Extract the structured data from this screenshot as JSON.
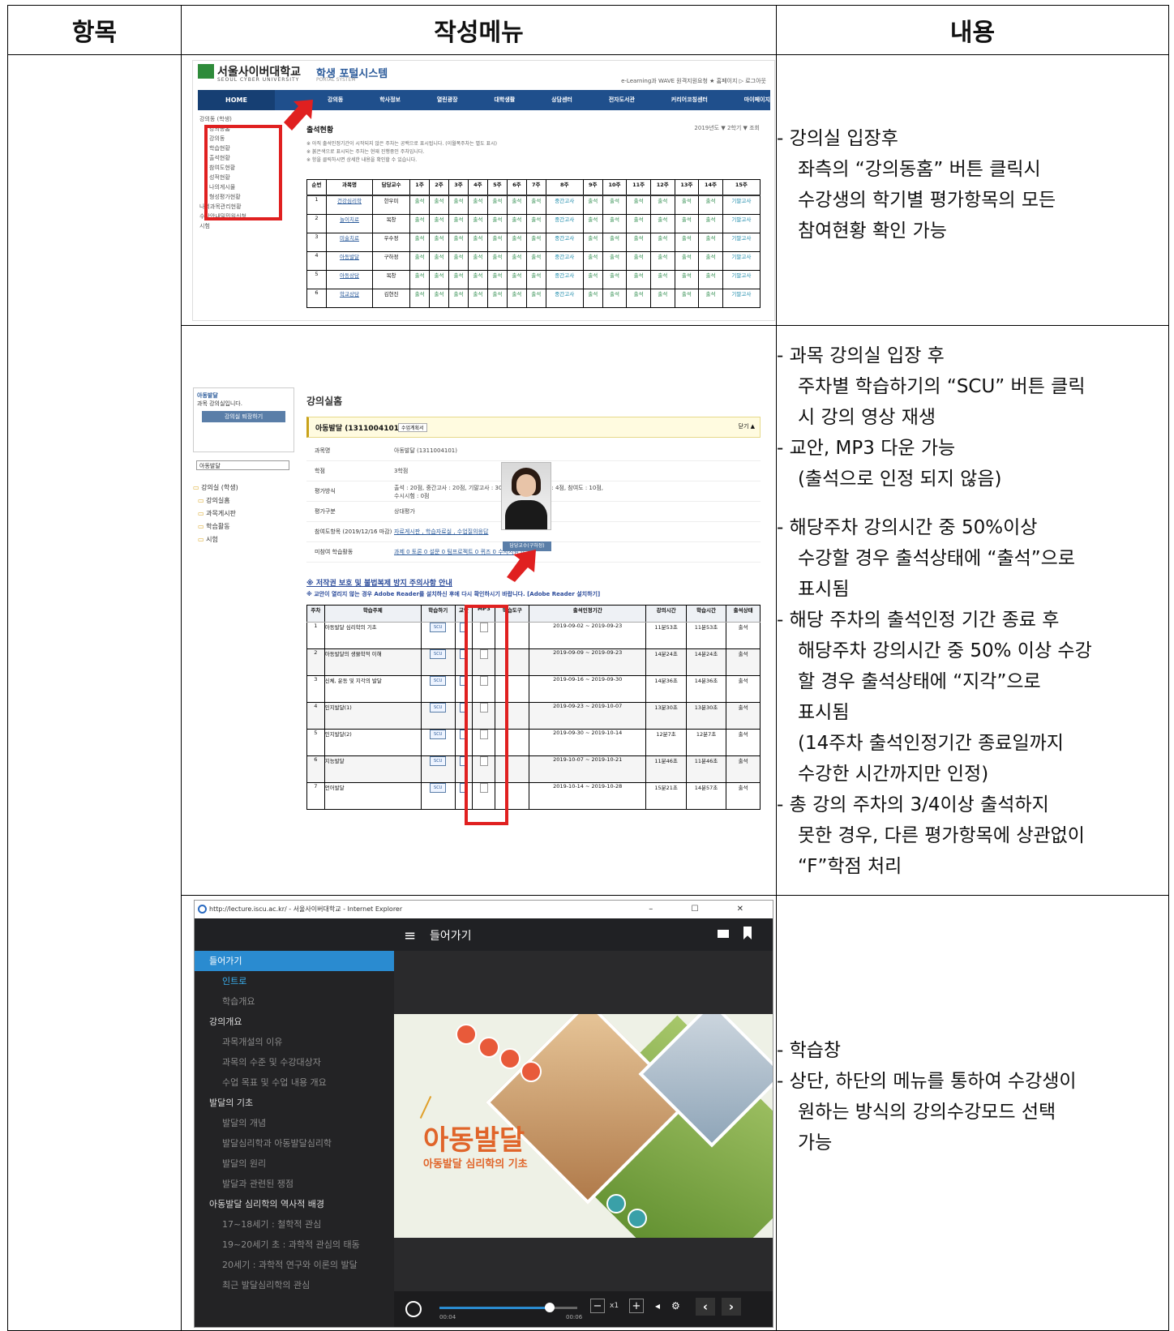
{
  "headers": [
    "항목",
    "작성메뉴",
    "내용"
  ],
  "row1": {
    "shot": {
      "logo_name": "서울사이버대학교",
      "logo_sub": "SEOUL CYBER UNIVERSITY",
      "portal_title": "학생 포털시스템",
      "portal_sub": "PORTAL SYSTEM",
      "top_links": "e-Learning과 WAVE   원격지원요청   ★ 홈페이지   ▷ 로그아웃",
      "nav_home": "HOME",
      "nav_items": [
        "강의동",
        "학사정보",
        "열린광장",
        "대학생활",
        "상담센터",
        "전자도서관",
        "커리어코칭센터",
        "마이페이지"
      ],
      "left_menu": [
        "강의동 (학생)",
        "강의동홈",
        "강의동",
        "학습현황",
        "출석현황",
        "참여도현황",
        "성적현황",
        "나의게시물",
        "형성평가현황",
        "나의과목관리현황",
        "수강안내및민원신청",
        "시험"
      ],
      "page_title": "출석현황",
      "notes": [
        "※ 아직 출석인정기간이 시작되지 않은 주차는 공백으로 표시됩니다. (이월폭주차는 별도 표시)",
        "※ 붉은색으로 표시되는 주차는 현재 진행중인 주차입니다.",
        "※ 항을 클릭하시면 상세한 내용을 확인할 수 있습니다."
      ],
      "select": "2019년도 ▼ 2학기 ▼ 조회",
      "columns": [
        "순번",
        "과목명",
        "담당교수",
        "1주",
        "2주",
        "3주",
        "4주",
        "5주",
        "6주",
        "7주",
        "8주",
        "9주",
        "10주",
        "11주",
        "12주",
        "13주",
        "14주",
        "15주"
      ],
      "rows": [
        {
          "no": "1",
          "course": "건강심리학",
          "prof": "한우미"
        },
        {
          "no": "2",
          "course": "놀이치료",
          "prof": "목창"
        },
        {
          "no": "3",
          "course": "미술치료",
          "prof": "우수정"
        },
        {
          "no": "4",
          "course": "아동발달",
          "prof": "구하정"
        },
        {
          "no": "5",
          "course": "아동상담",
          "prof": "목창"
        },
        {
          "no": "6",
          "course": "학교상담",
          "prof": "김현진"
        }
      ],
      "cell_attend": "출석",
      "cell_mid": "중간고사",
      "cell_final": "기말고사"
    },
    "desc": [
      "- 강의실 입장후",
      "좌측의 “강의동홈” 버튼 클릭시",
      "수강생의 학기별 평가항목의 모든",
      "참여현황 확인 가능"
    ]
  },
  "row2": {
    "shot": {
      "side_course": "아동발달",
      "side_text": "과목 강의실입니다.",
      "side_btn": "강의실 퇴장하기",
      "side_select": "아동발달",
      "side_tree": [
        "강의실 (학생)",
        "강의실홈",
        "과목게시판",
        "학습활동",
        "시험"
      ],
      "title": "강의실홈",
      "course": "아동발달 (1311004101)",
      "course_tag": "수업계획서",
      "course_hide": "닫기 ▲",
      "info": [
        {
          "k": "과목명",
          "v": "아동발달 (1311004101)"
        },
        {
          "k": "학점",
          "v": "3학점"
        },
        {
          "k": "평가방식",
          "v": "출석 : 20점, 중간고사 : 20점, 기말고사 : 30점, 과제 : 0점, 토론 : 4점, 참여도 : 10점, 수시시험 : 0점"
        },
        {
          "k": "평가구분",
          "v": "상대평가"
        },
        {
          "k": "참여도항목 (2019/12/16 마감)",
          "v": "자료게시판 , 학습자료실 , 수업질의응답"
        },
        {
          "k": "미참여 학습활동",
          "v": "과제 0  토론 0  설문 0  팀프로젝트 0  퀴즈 0  수시시험 0"
        }
      ],
      "teacher_btn": "담당교수(구하정)",
      "copy_title": "※ 저작권 보호 및 불법복제 방지 주의사항 안내",
      "copy_note": "※ 교안이 열리지 않는 경우 Adobe Reader를 설치하신 후에 다시 확인하시기 바랍니다. [Adobe Reader 설치하기]",
      "columns": [
        "주차",
        "학습주제",
        "학습하기",
        "교안",
        "MP3",
        "학습도구",
        "출석인정기간",
        "강의시간",
        "학습시간",
        "출석상태"
      ],
      "scu": "SCU",
      "rows": [
        {
          "wk": "1",
          "topic": "아동발달 심리학의 기초",
          "period": "2019-09-02 ~ 2019-09-23",
          "lt": "11분53초",
          "st": "11분53초",
          "status": "출석"
        },
        {
          "wk": "2",
          "topic": "아동발달의 생물학적 이해",
          "period": "2019-09-09 ~ 2019-09-23",
          "lt": "14분24초",
          "st": "14분24초",
          "status": "출석"
        },
        {
          "wk": "3",
          "topic": "신체, 운동 및 지각의 발달",
          "period": "2019-09-16 ~ 2019-09-30",
          "lt": "14분36초",
          "st": "14분36초",
          "status": "출석"
        },
        {
          "wk": "4",
          "topic": "인지발달(1)",
          "period": "2019-09-23 ~ 2019-10-07",
          "lt": "13분30초",
          "st": "13분30초",
          "status": "출석"
        },
        {
          "wk": "5",
          "topic": "인지발달(2)",
          "period": "2019-09-30 ~ 2019-10-14",
          "lt": "12분7초",
          "st": "12분7초",
          "status": "출석"
        },
        {
          "wk": "6",
          "topic": "지능발달",
          "period": "2019-10-07 ~ 2019-10-21",
          "lt": "11분46초",
          "st": "11분46초",
          "status": "출석"
        },
        {
          "wk": "7",
          "topic": "언어발달",
          "period": "2019-10-14 ~ 2019-10-28",
          "lt": "15분21초",
          "st": "14분57초",
          "status": "출석"
        }
      ]
    },
    "desc": [
      {
        "t": "- 과목 강의실 입장 후",
        "ind": false
      },
      {
        "t": "주차별 학습하기의 “SCU” 버튼 클릭",
        "ind": true
      },
      {
        "t": "시 강의 영상 재생",
        "ind": true
      },
      {
        "t": "- 교안, MP3 다운 가능",
        "ind": false
      },
      {
        "t": "(출석으로 인정 되지 않음)",
        "ind": true
      },
      {
        "t": "",
        "ind": false,
        "gap": true
      },
      {
        "t": "- 해당주차 강의시간 중 50%이상",
        "ind": false
      },
      {
        "t": "수강할 경우 출석상태에 “출석”으로",
        "ind": true
      },
      {
        "t": "표시됨",
        "ind": true
      },
      {
        "t": "- 해당 주차의 출석인정 기간 종료 후",
        "ind": false
      },
      {
        "t": "해당주차 강의시간 중 50% 이상 수강",
        "ind": true
      },
      {
        "t": "할 경우 출석상태에 “지각”으로",
        "ind": true
      },
      {
        "t": "표시됨",
        "ind": true
      },
      {
        "t": "(14주차 출석인정기간 종료일까지",
        "ind": true
      },
      {
        "t": "수강한 시간까지만 인정)",
        "ind": true
      },
      {
        "t": "- 총 강의 주차의 3/4이상 출석하지",
        "ind": false
      },
      {
        "t": "못한 경우, 다른 평가항목에 상관없이",
        "ind": true
      },
      {
        "t": "“F”학점 처리",
        "ind": true
      }
    ]
  },
  "row3": {
    "shot": {
      "url": "http://lecture.iscu.ac.kr/ - 서울사이버대학교 - Internet Explorer",
      "win_btns": "–  ☐  ✕",
      "menu_title": "들어가기",
      "toc": [
        {
          "t": "들어가기",
          "k": "active"
        },
        {
          "t": "인트로",
          "k": "cur"
        },
        {
          "t": "학습개요",
          "k": "sub"
        },
        {
          "t": "강의개요",
          "k": "sec"
        },
        {
          "t": "과목개설의 이유",
          "k": "sub"
        },
        {
          "t": "과목의 수준 및 수강대상자",
          "k": "sub"
        },
        {
          "t": "수업 목표 및 수업 내용 개요",
          "k": "sub"
        },
        {
          "t": "발달의 기초",
          "k": "sec"
        },
        {
          "t": "발달의 개념",
          "k": "sub"
        },
        {
          "t": "발달심리학과 아동발달심리학",
          "k": "sub"
        },
        {
          "t": "발달의 원리",
          "k": "sub"
        },
        {
          "t": "발달과 관련된 쟁점",
          "k": "sub"
        },
        {
          "t": "아동발달 심리학의 역사적 배경",
          "k": "sec"
        },
        {
          "t": "17~18세기 : 철학적 관심",
          "k": "sub"
        },
        {
          "t": "19~20세기 초 : 과학적 관심의 태동",
          "k": "sub"
        },
        {
          "t": "20세기 : 과학적 연구와 이론의 발달",
          "k": "sub"
        },
        {
          "t": "최근 발달심리학의 관심",
          "k": "sub"
        }
      ],
      "stage_title": "아동발달",
      "stage_subtitle": "아동발달 심리학의 기초",
      "time_cur": "00:04",
      "time_total": "00:06",
      "progress": 0.8,
      "speed": "x1"
    },
    "desc": [
      {
        "t": "- 학습창",
        "ind": false
      },
      {
        "t": "- 상단, 하단의 메뉴를 통하여 수강생이",
        "ind": false
      },
      {
        "t": "원하는 방식의 강의수강모드 선택",
        "ind": true
      },
      {
        "t": "가능",
        "ind": true
      }
    ]
  }
}
